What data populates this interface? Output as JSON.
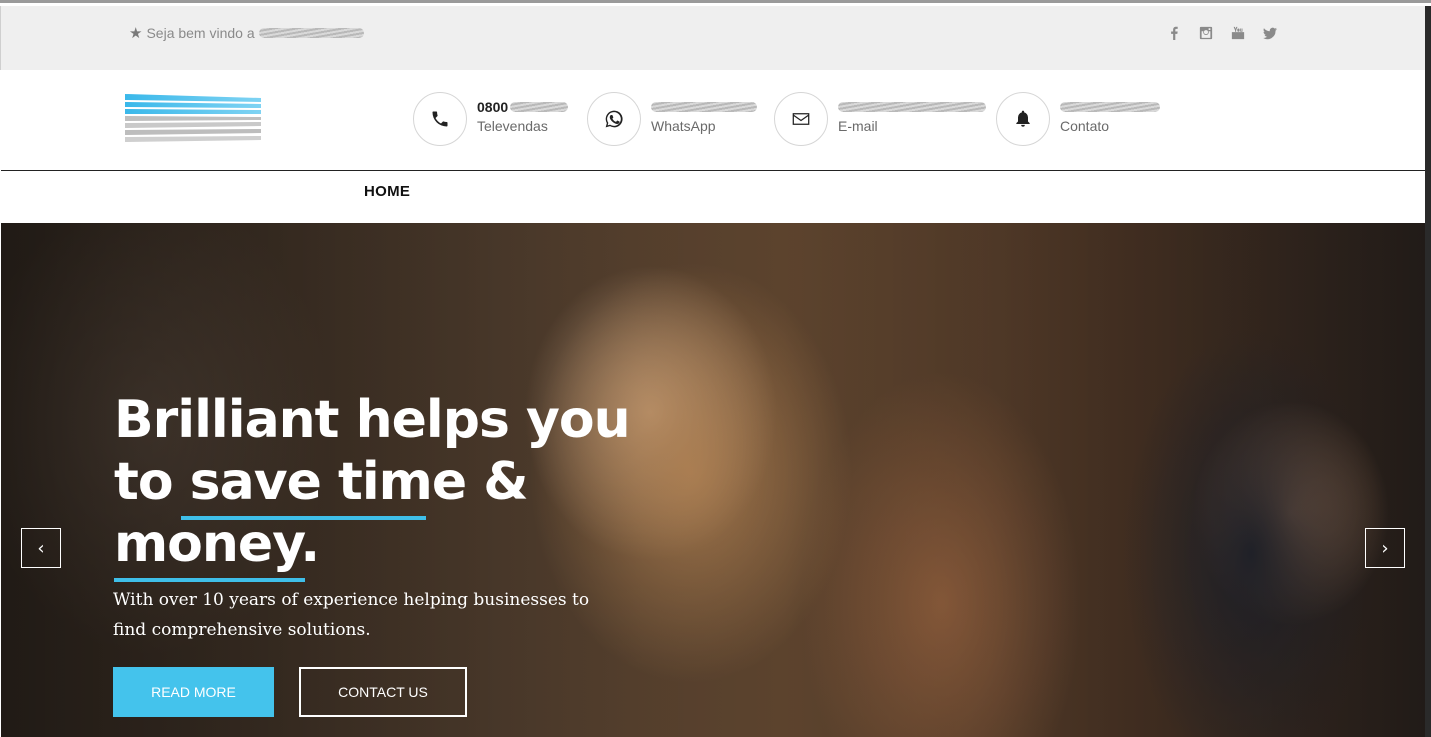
{
  "topbar": {
    "welcome_text": "Seja bem vindo a",
    "social": [
      "facebook-icon",
      "instagram-icon",
      "youtube-icon",
      "twitter-icon"
    ]
  },
  "header": {
    "contacts": [
      {
        "icon": "phone-icon",
        "value": "0800",
        "label": "Televendas"
      },
      {
        "icon": "whatsapp-icon",
        "value": "",
        "label": "WhatsApp"
      },
      {
        "icon": "envelope-icon",
        "value": "",
        "label": "E-mail"
      },
      {
        "icon": "bell-icon",
        "value": "",
        "label": "Contato"
      }
    ]
  },
  "nav": {
    "items": [
      "HOME"
    ]
  },
  "hero": {
    "title_line1": "Brilliant helps you",
    "title_line2": "to save time &",
    "title_line3": "money.",
    "subtitle": "With over 10 years of experience helping businesses to find comprehensive solutions.",
    "read_more": "READ MORE",
    "contact_us": "CONTACT US",
    "prev_arrow": "‹",
    "next_arrow": "›"
  },
  "colors": {
    "accent": "#44c3ec",
    "topbar_bg": "#efefef"
  }
}
